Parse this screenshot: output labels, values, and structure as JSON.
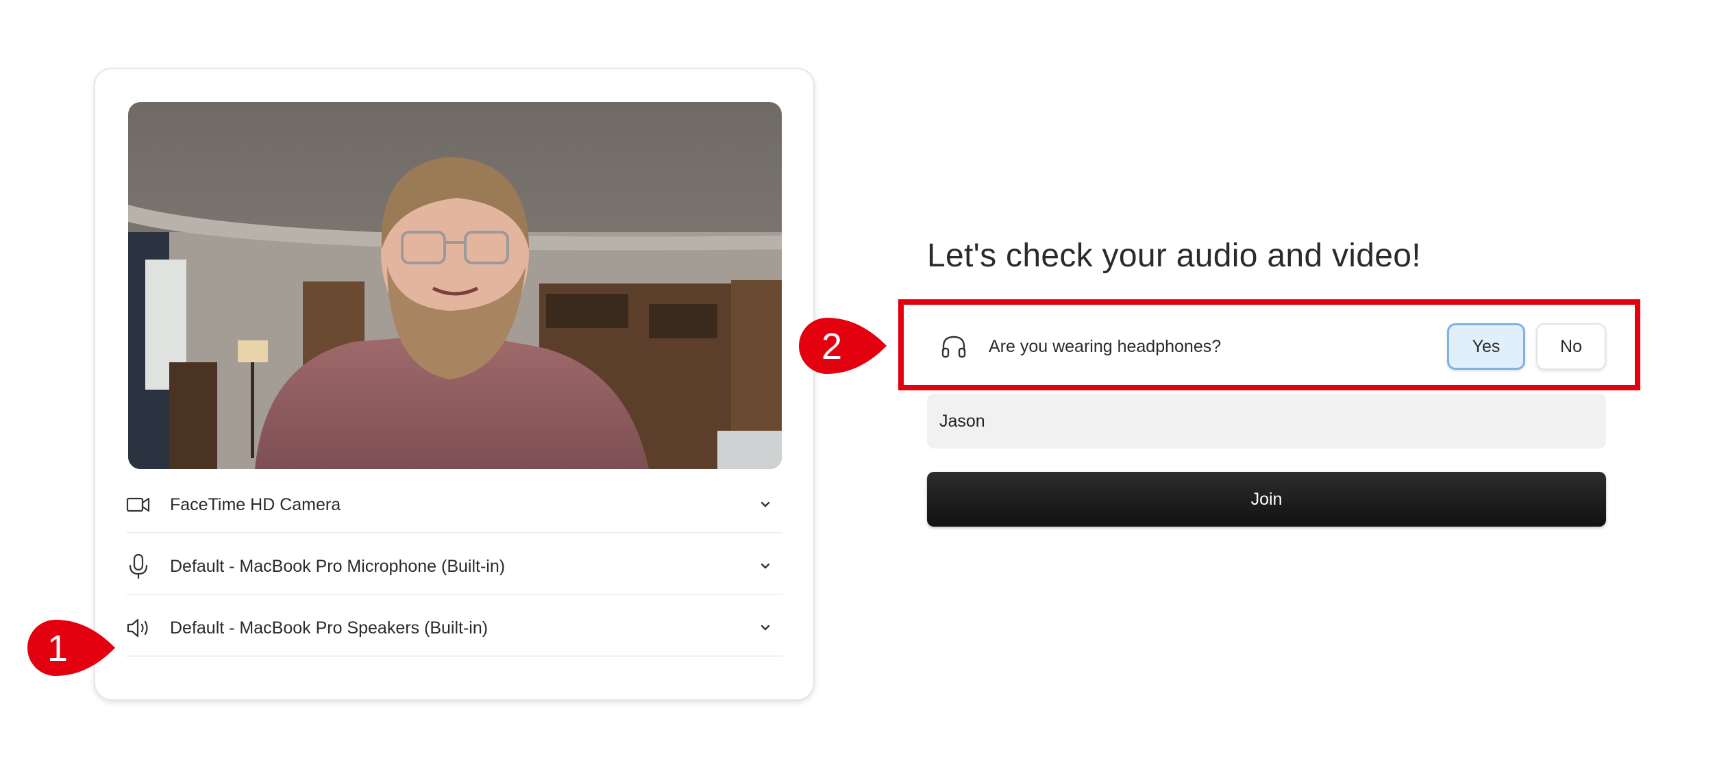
{
  "devices": [
    {
      "label": "FaceTime HD Camera",
      "icon": "video-camera-icon"
    },
    {
      "label": "Default - MacBook Pro Microphone (Built-in)",
      "icon": "microphone-icon"
    },
    {
      "label": "Default - MacBook Pro Speakers (Built-in)",
      "icon": "speaker-icon"
    }
  ],
  "main": {
    "title": "Let's check your audio and video!",
    "headphones": {
      "question": "Are you wearing headphones?",
      "icon": "headphones-icon",
      "yes_label": "Yes",
      "no_label": "No",
      "selected": "Yes"
    },
    "name_value": "Jason",
    "join_label": "Join"
  },
  "annotations": [
    {
      "number": "1"
    },
    {
      "number": "2"
    }
  ],
  "colors": {
    "annotation_red": "#e3000f",
    "selected_fill": "#e1effb",
    "selected_border": "#7bb2e8",
    "join_button": "#1f1f1f"
  }
}
